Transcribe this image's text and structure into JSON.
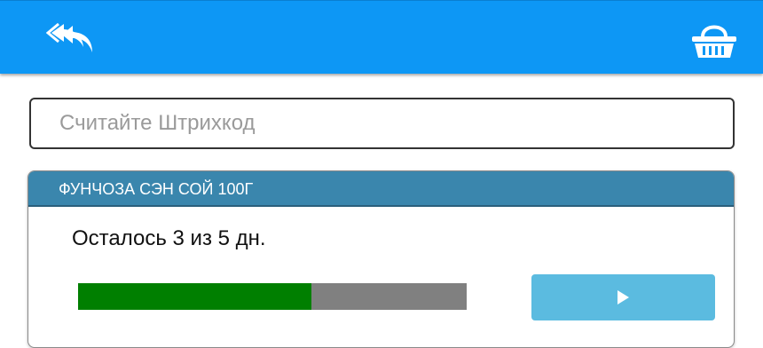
{
  "topbar": {
    "back_icon": "double-back-arrow-icon",
    "basket_icon": "basket-icon",
    "color": "#0d97f5"
  },
  "barcode": {
    "placeholder": "Считайте Штрихкод",
    "value": ""
  },
  "product": {
    "name": "ФУНЧОЗА СЭН СОЙ 100Г",
    "remaining_text": "Осталось 3 из 5 дн.",
    "progress_fraction": 0.6,
    "play_icon": "play-icon"
  }
}
